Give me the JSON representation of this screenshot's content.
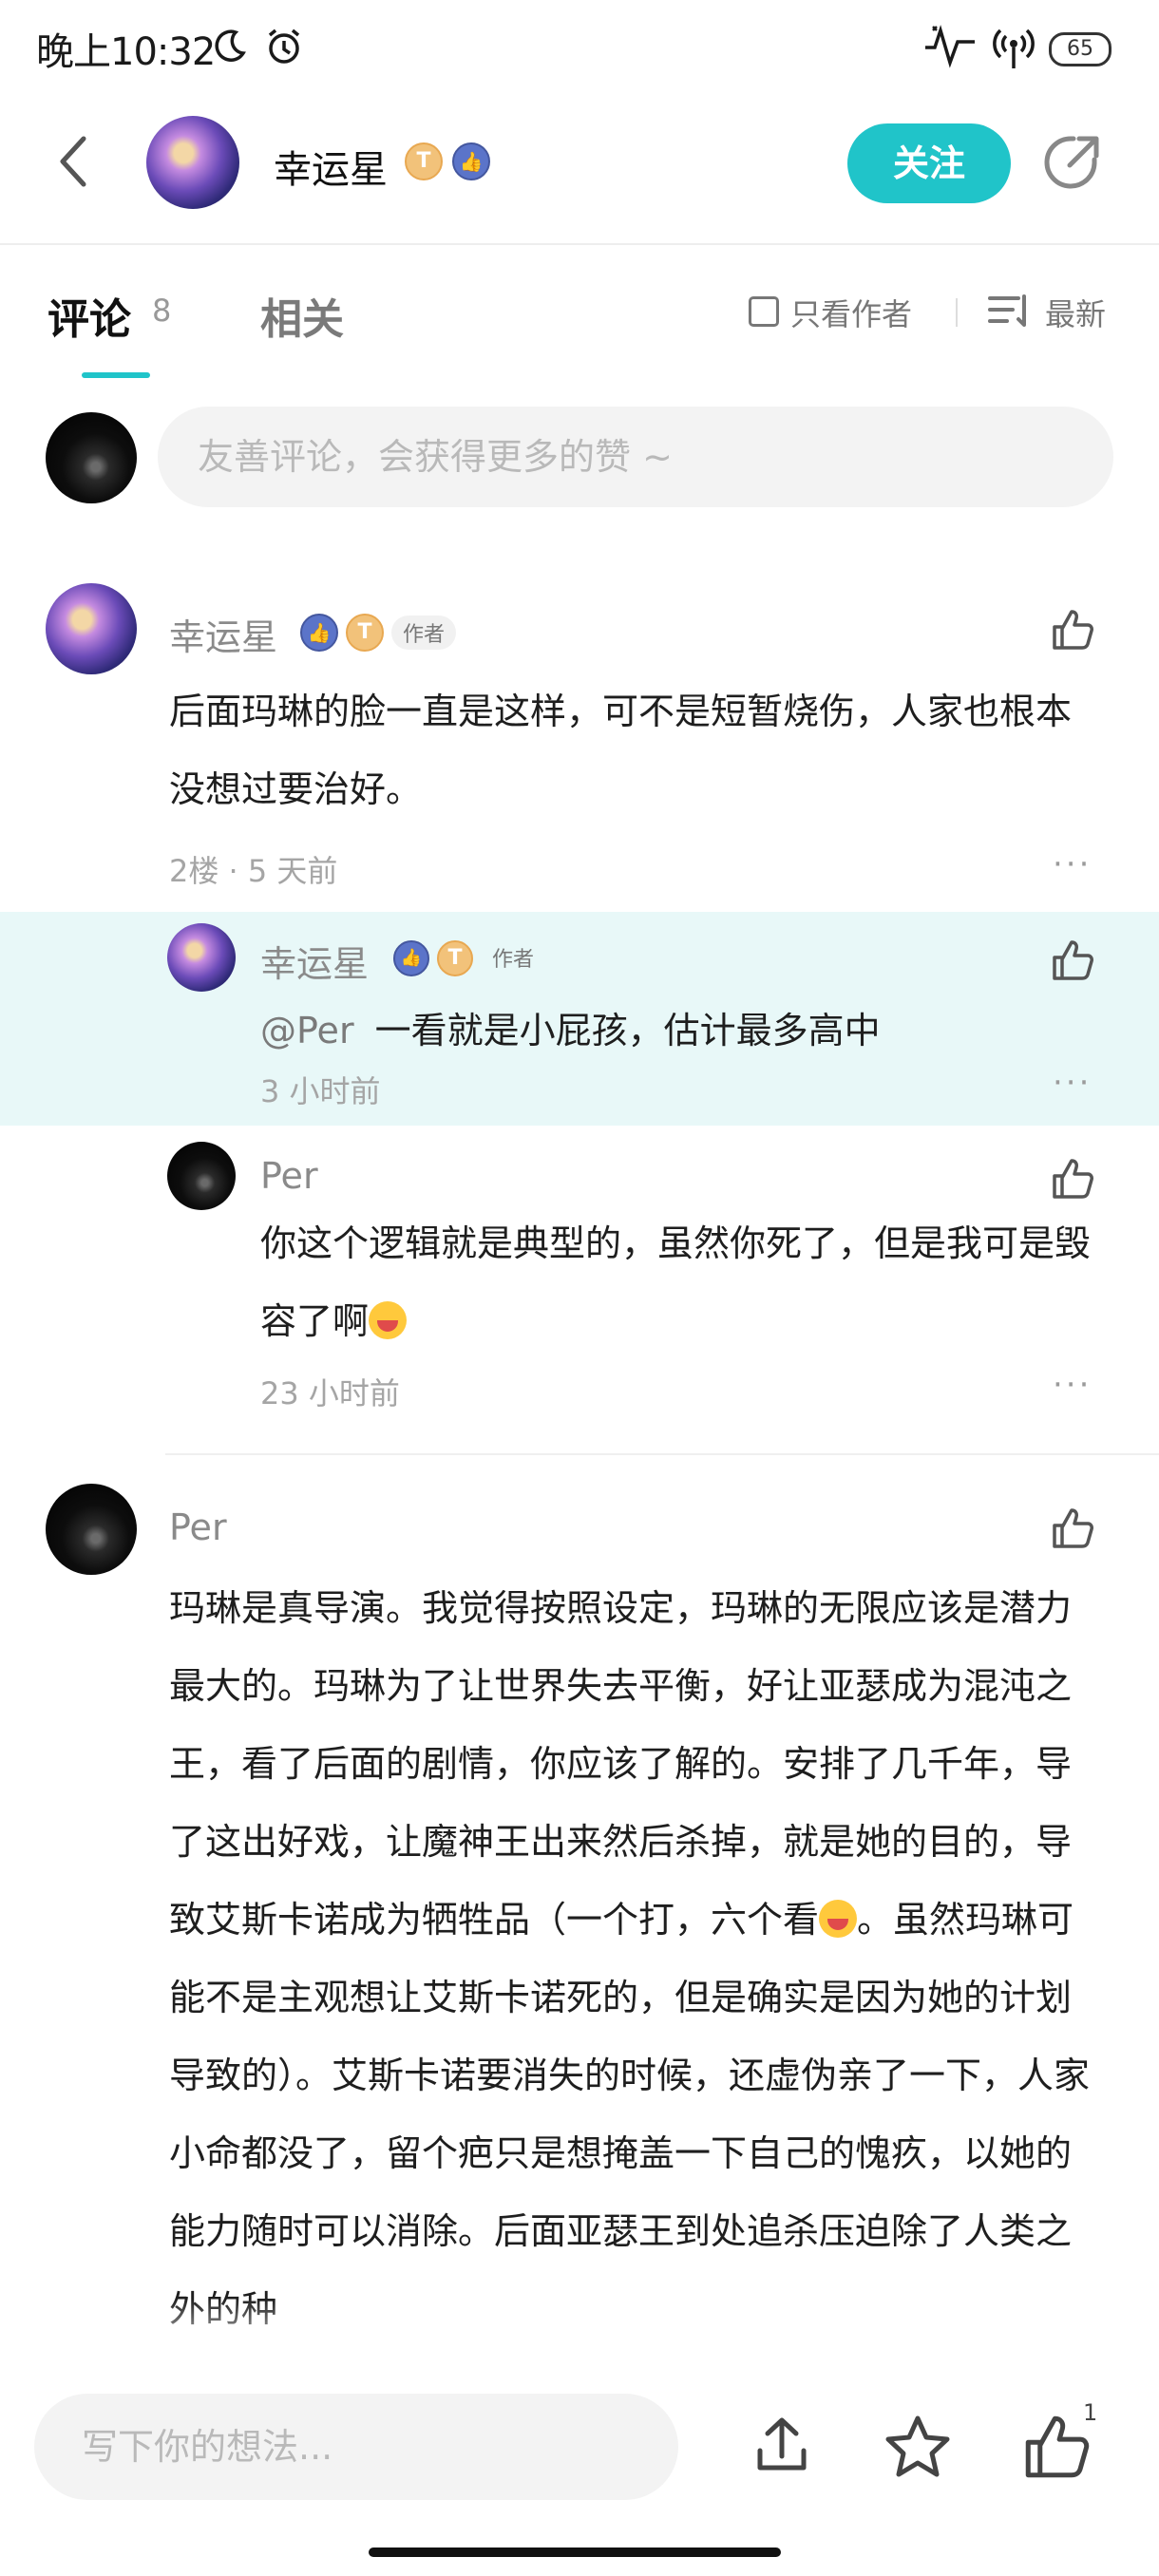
{
  "status_bar": {
    "time": "晚上10:32",
    "battery": "65",
    "icons": [
      "moon-icon",
      "alarm-icon",
      "activity-icon",
      "hotspot-icon",
      "battery-icon"
    ]
  },
  "header": {
    "author_name": "幸运星",
    "author_badge_letter": "T",
    "follow_label": "关注",
    "icons": [
      "back-icon",
      "share-icon",
      "thumb-badge-icon"
    ]
  },
  "tabs": {
    "comments_label": "评论",
    "comments_count": "8",
    "related_label": "相关",
    "author_only_label": "只看作者",
    "sort_label": "最新"
  },
  "comment_box": {
    "placeholder": "友善评论，会获得更多的赞 ~"
  },
  "comments": [
    {
      "name": "幸运星",
      "author_tag": "作者",
      "badge_letter": "T",
      "text": "后面玛琳的脸一直是这样，可不是短暂烧伤，人家也根本没想过要治好。",
      "meta": "2楼 · 5 天前",
      "more": "···",
      "replies": [
        {
          "name": "幸运星",
          "author_tag": "作者",
          "badge_letter": "T",
          "mention": "@Per",
          "text": "一看就是小屁孩，估计最多高中",
          "meta": "3 小时前",
          "more": "···"
        },
        {
          "name": "Per",
          "text": "你这个逻辑就是典型的，虽然你死了，但是我可是毁容了啊",
          "meta": "23 小时前",
          "more": "···"
        }
      ]
    },
    {
      "name": "Per",
      "text_part1": "玛琳是真导演。我觉得按照设定，玛琳的无限应该是潜力最大的。玛琳为了让世界失去平衡，好让亚瑟成为混沌之王，看了后面的剧情，你应该了解的。安排了几千年，导了这出好戏，让魔神王出来然后杀掉，就是她的目的，导致艾斯卡诺成为牺牲品（一个打，六个看",
      "text_part2": "。虽然玛琳可能不是主观想让艾斯卡诺死的，但是确实是因为她的计划导致的）。艾斯卡诺要消失的时候，还虚伪亲了一下，人家小命都没了，留个疤只是想掩盖一下自己的愧疚，以她的能力随时可以消除。后面亚瑟王到处追杀压迫除了人类之外的种"
    }
  ],
  "bottom_bar": {
    "placeholder": "写下你的想法...",
    "like_count": "1"
  },
  "colors": {
    "accent": "#20c4c9",
    "highlight_bg": "#e8f8f8"
  }
}
